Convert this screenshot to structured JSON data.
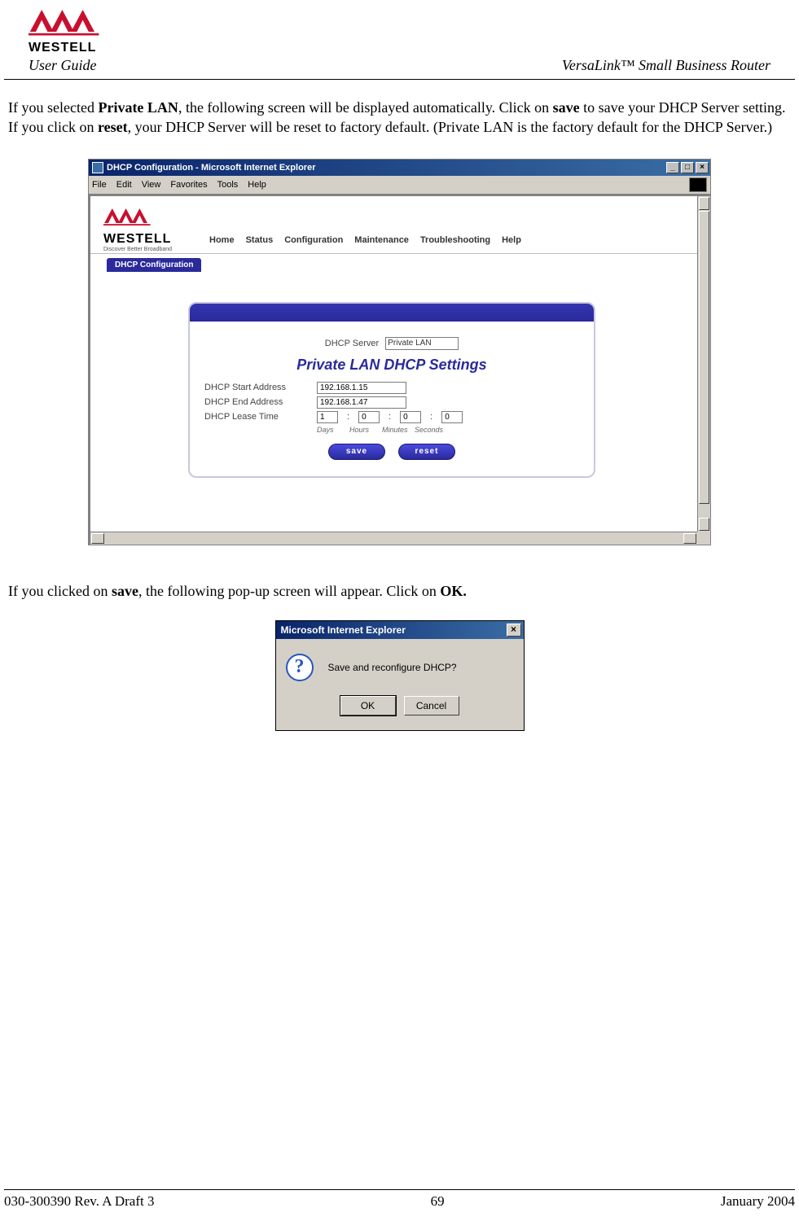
{
  "header": {
    "brand": "WESTELL",
    "user_guide": "User Guide",
    "product": "VersaLink™  Small Business Router"
  },
  "para1": {
    "t1": "If you selected ",
    "b1": "Private LAN",
    "t2": ", the following screen will be displayed automatically. Click on ",
    "b2": "save",
    "t3": " to save your DHCP Server setting. If you click on ",
    "b3": "reset",
    "t4": ", your DHCP Server will be reset to factory default. (Private LAN is the factory default for the DHCP Server.)"
  },
  "ie": {
    "title": "DHCP Configuration - Microsoft Internet Explorer",
    "menus": {
      "file": "File",
      "edit": "Edit",
      "view": "View",
      "favorites": "Favorites",
      "tools": "Tools",
      "help": "Help"
    },
    "win_btns": {
      "min": "_",
      "max": "□",
      "close": "×"
    }
  },
  "router": {
    "brand": "WESTELL",
    "tagline": "Discover Better Broadband",
    "nav": {
      "home": "Home",
      "status": "Status",
      "configuration": "Configuration",
      "maintenance": "Maintenance",
      "troubleshooting": "Troubleshooting",
      "help": "Help"
    },
    "tab": "DHCP Configuration"
  },
  "panel": {
    "dhcp_server_label": "DHCP Server",
    "dhcp_server_value": "Private LAN",
    "title": "Private LAN DHCP Settings",
    "start_label": "DHCP Start Address",
    "start_value": "192.168.1.15",
    "end_label": "DHCP End Address",
    "end_value": "192.168.1.47",
    "lease_label": "DHCP Lease Time",
    "lease": {
      "days": "1",
      "hours": "0",
      "minutes": "0",
      "seconds": "0"
    },
    "units": {
      "days": "Days",
      "hours": "Hours",
      "minutes": "Minutes",
      "seconds": "Seconds"
    },
    "save": "save",
    "reset": "reset"
  },
  "para2": {
    "t1": "If you clicked on ",
    "b1": "save",
    "t2": ", the following pop-up screen will appear. Click on ",
    "b2": "OK."
  },
  "dialog": {
    "title": "Microsoft Internet Explorer",
    "close": "×",
    "icon": "?",
    "message": "Save and reconfigure DHCP?",
    "ok": "OK",
    "cancel": "Cancel"
  },
  "footer": {
    "left": "030-300390 Rev. A Draft 3",
    "center": "69",
    "right": "January 2004"
  }
}
